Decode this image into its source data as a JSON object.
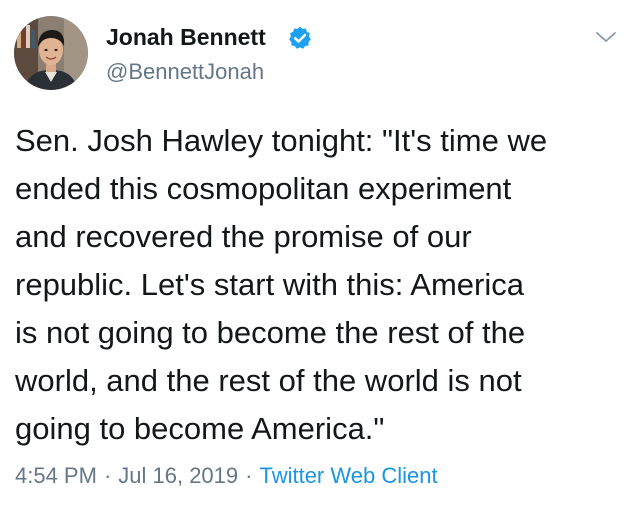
{
  "author": {
    "display_name": "Jonah Bennett",
    "handle": "@BennettJonah",
    "verified": true
  },
  "tweet": {
    "text": "Sen. Josh Hawley tonight: \"It's time we\nended this cosmopolitan experiment\nand recovered the promise of our\nrepublic. Let's start with this: America\nis not going to become the rest of the\nworld, and the rest of the world is not\ngoing to become America.\"",
    "time": "4:54 PM",
    "date": "Jul 16, 2019",
    "separator": "·",
    "client": "Twitter Web Client"
  },
  "colors": {
    "text": "#14171a",
    "secondary": "#657786",
    "link": "#1b95e0",
    "verified": "#1da1f2"
  },
  "icons": {
    "verified": "verified-badge-icon",
    "menu": "chevron-down-icon"
  }
}
